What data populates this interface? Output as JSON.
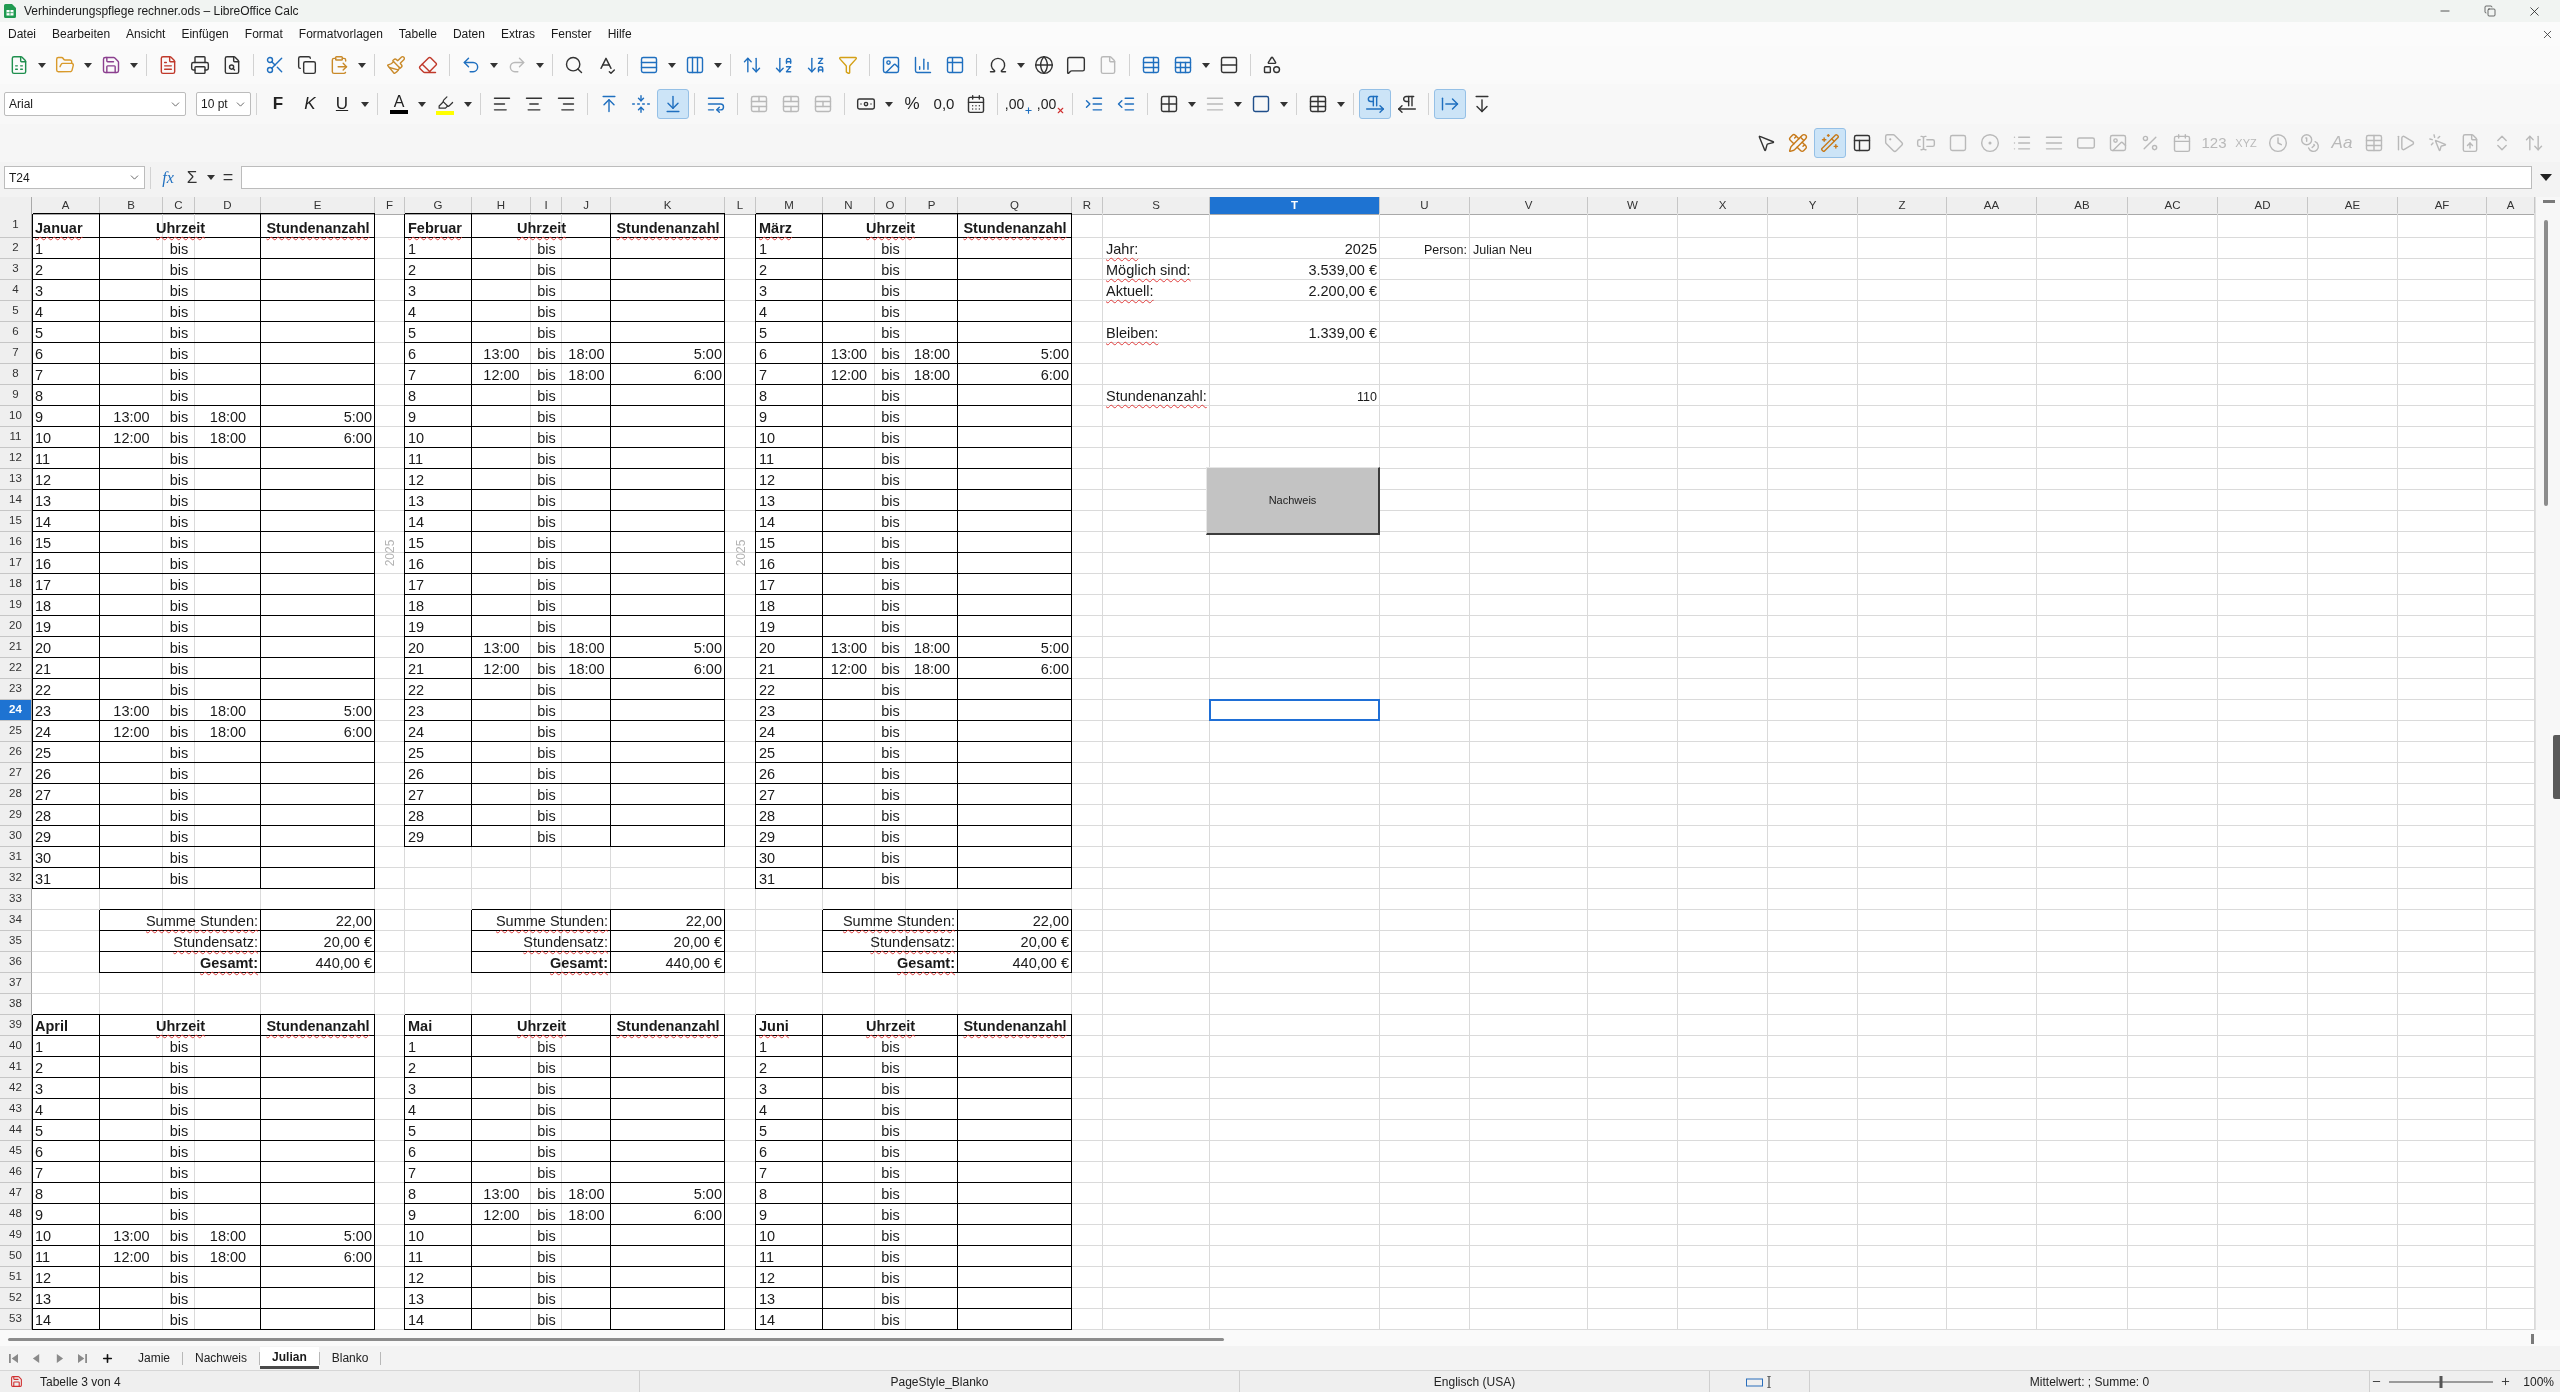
{
  "window": {
    "title": "Verhinderungspflege rechner.ods – LibreOffice Calc"
  },
  "menu": [
    "Datei",
    "Bearbeiten",
    "Ansicht",
    "Einfügen",
    "Format",
    "Formatvorlagen",
    "Tabelle",
    "Daten",
    "Extras",
    "Fenster",
    "Hilfe"
  ],
  "standard_toolbar": [
    {
      "disabled": false
    },
    {
      "disabled": false
    },
    {
      "disabled": false
    },
    {
      "disabled": false
    },
    {
      "disabled": false
    },
    {
      "disabled": false
    },
    {
      "disabled": false
    },
    {
      "disabled": false
    },
    {
      "disabled": false
    },
    {
      "disabled": false
    },
    {
      "disabled": false
    },
    {
      "disabled": false
    },
    {
      "disabled": true
    },
    {
      "disabled": false
    },
    {
      "disabled": false
    },
    {
      "disabled": false
    },
    {
      "disabled": false
    },
    {
      "disabled": false
    },
    {
      "disabled": false
    },
    {
      "disabled": false
    },
    {
      "disabled": false
    },
    {
      "disabled": false
    },
    {
      "disabled": false
    },
    {
      "disabled": false
    },
    {
      "disabled": false
    },
    {
      "disabled": false
    },
    {
      "disabled": false
    },
    {
      "disabled": true
    },
    {
      "disabled": false
    },
    {
      "disabled": false
    },
    {
      "disabled": false
    },
    {
      "disabled": false
    }
  ],
  "formatting_toolbar": {
    "font_name": "Arial",
    "font_size": "10 pt",
    "buttons": [
      {
        "kind": "glyph",
        "label": "F",
        "pressed": false,
        "disabled": false
      },
      {
        "kind": "glyph",
        "label": "K",
        "pressed": false,
        "disabled": false
      },
      {
        "kind": "glyph",
        "label": "U",
        "pressed": false,
        "disabled": false
      },
      {
        "kind": "glyph",
        "label": "A",
        "pressed": false,
        "disabled": false
      },
      {
        "kind": "icon",
        "pressed": false,
        "disabled": false
      },
      {
        "kind": "icon",
        "pressed": false,
        "disabled": false
      },
      {
        "kind": "icon",
        "pressed": false,
        "disabled": false
      },
      {
        "kind": "icon",
        "pressed": false,
        "disabled": false
      },
      {
        "kind": "icon",
        "pressed": false,
        "disabled": false
      },
      {
        "kind": "icon",
        "pressed": false,
        "disabled": false
      },
      {
        "kind": "icon",
        "pressed": true,
        "disabled": false
      },
      {
        "kind": "icon",
        "pressed": false,
        "disabled": false
      },
      {
        "kind": "icon",
        "pressed": false,
        "disabled": true
      },
      {
        "kind": "icon",
        "pressed": false,
        "disabled": true
      },
      {
        "kind": "icon",
        "pressed": false,
        "disabled": true
      },
      {
        "kind": "icon",
        "pressed": false,
        "disabled": false
      },
      {
        "kind": "glyph",
        "label": "%",
        "pressed": false,
        "disabled": false
      },
      {
        "kind": "glyph",
        "label": "0,0",
        "pressed": false,
        "disabled": false
      },
      {
        "kind": "icon",
        "pressed": false,
        "disabled": false
      },
      {
        "kind": "glyph",
        "label": ",00",
        "pressed": false,
        "disabled": false
      },
      {
        "kind": "glyph",
        "label": ",00",
        "pressed": false,
        "disabled": false
      },
      {
        "kind": "icon",
        "pressed": false,
        "disabled": false
      },
      {
        "kind": "icon",
        "pressed": false,
        "disabled": false
      },
      {
        "kind": "icon",
        "pressed": false,
        "disabled": false
      },
      {
        "kind": "icon",
        "pressed": false,
        "disabled": true
      },
      {
        "kind": "icon",
        "pressed": false,
        "disabled": false
      },
      {
        "kind": "icon",
        "pressed": false,
        "disabled": false
      },
      {
        "kind": "icon",
        "pressed": true,
        "disabled": false
      },
      {
        "kind": "icon",
        "pressed": false,
        "disabled": false
      },
      {
        "kind": "icon",
        "pressed": true,
        "disabled": false
      },
      {
        "kind": "icon",
        "pressed": false,
        "disabled": false
      }
    ]
  },
  "form_controls_toolbar": [
    {
      "kind": "icon",
      "pressed": false,
      "disabled": false
    },
    {
      "kind": "icon",
      "pressed": false,
      "disabled": false
    },
    {
      "kind": "icon",
      "pressed": true,
      "disabled": false
    },
    {
      "kind": "icon",
      "pressed": false,
      "disabled": false
    },
    {
      "kind": "icon",
      "pressed": false,
      "disabled": true
    },
    {
      "kind": "icon",
      "pressed": false,
      "disabled": true
    },
    {
      "kind": "icon",
      "pressed": false,
      "disabled": true
    },
    {
      "kind": "icon",
      "pressed": false,
      "disabled": true
    },
    {
      "kind": "icon",
      "pressed": false,
      "disabled": true
    },
    {
      "kind": "icon",
      "pressed": false,
      "disabled": true
    },
    {
      "kind": "icon",
      "pressed": false,
      "disabled": true
    },
    {
      "kind": "icon",
      "pressed": false,
      "disabled": true
    },
    {
      "kind": "icon",
      "pressed": false,
      "disabled": true
    },
    {
      "kind": "icon",
      "pressed": false,
      "disabled": true
    },
    {
      "kind": "glyph",
      "label": "123",
      "pressed": false,
      "disabled": true
    },
    {
      "kind": "glyph",
      "label": "XYZ",
      "pressed": false,
      "disabled": true
    },
    {
      "kind": "icon",
      "pressed": false,
      "disabled": true
    },
    {
      "kind": "icon",
      "pressed": false,
      "disabled": true
    },
    {
      "kind": "glyph",
      "label": "Aa",
      "pressed": false,
      "disabled": true
    },
    {
      "kind": "icon",
      "pressed": false,
      "disabled": true
    },
    {
      "kind": "icon",
      "pressed": false,
      "disabled": true
    },
    {
      "kind": "icon",
      "pressed": false,
      "disabled": true
    },
    {
      "kind": "icon",
      "pressed": false,
      "disabled": true
    },
    {
      "kind": "icon",
      "pressed": false,
      "disabled": true
    },
    {
      "kind": "icon",
      "pressed": false,
      "disabled": true
    }
  ],
  "formula_bar": {
    "name_box": "T24",
    "function_wizard": "fx",
    "sum": "Σ",
    "equals": "="
  },
  "sheet": {
    "columns": [
      {
        "label": "A",
        "selected": false
      },
      {
        "label": "B",
        "selected": false
      },
      {
        "label": "C",
        "selected": false
      },
      {
        "label": "D",
        "selected": false
      },
      {
        "label": "E",
        "selected": false
      },
      {
        "label": "F",
        "selected": false
      },
      {
        "label": "G",
        "selected": false
      },
      {
        "label": "H",
        "selected": false
      },
      {
        "label": "I",
        "selected": false
      },
      {
        "label": "J",
        "selected": false
      },
      {
        "label": "K",
        "selected": false
      },
      {
        "label": "L",
        "selected": false
      },
      {
        "label": "M",
        "selected": false
      },
      {
        "label": "N",
        "selected": false
      },
      {
        "label": "O",
        "selected": false
      },
      {
        "label": "P",
        "selected": false
      },
      {
        "label": "Q",
        "selected": false
      },
      {
        "label": "R",
        "selected": false
      },
      {
        "label": "S",
        "selected": false
      },
      {
        "label": "T",
        "selected": true
      },
      {
        "label": "U",
        "selected": false
      },
      {
        "label": "V",
        "selected": false
      },
      {
        "label": "W",
        "selected": false
      },
      {
        "label": "X",
        "selected": false
      },
      {
        "label": "Y",
        "selected": false
      },
      {
        "label": "Z",
        "selected": false
      },
      {
        "label": "AA",
        "selected": false
      },
      {
        "label": "AB",
        "selected": false
      },
      {
        "label": "AC",
        "selected": false
      },
      {
        "label": "AD",
        "selected": false
      },
      {
        "label": "AE",
        "selected": false
      },
      {
        "label": "AF",
        "selected": false
      },
      {
        "label": "A",
        "selected": false
      }
    ],
    "rows": [
      {
        "label": "1",
        "selected": false
      },
      {
        "label": "2",
        "selected": false
      },
      {
        "label": "3",
        "selected": false
      },
      {
        "label": "4",
        "selected": false
      },
      {
        "label": "5",
        "selected": false
      },
      {
        "label": "6",
        "selected": false
      },
      {
        "label": "7",
        "selected": false
      },
      {
        "label": "8",
        "selected": false
      },
      {
        "label": "9",
        "selected": false
      },
      {
        "label": "10",
        "selected": false
      },
      {
        "label": "11",
        "selected": false
      },
      {
        "label": "12",
        "selected": false
      },
      {
        "label": "13",
        "selected": false
      },
      {
        "label": "14",
        "selected": false
      },
      {
        "label": "15",
        "selected": false
      },
      {
        "label": "16",
        "selected": false
      },
      {
        "label": "17",
        "selected": false
      },
      {
        "label": "18",
        "selected": false
      },
      {
        "label": "19",
        "selected": false
      },
      {
        "label": "20",
        "selected": false
      },
      {
        "label": "21",
        "selected": false
      },
      {
        "label": "22",
        "selected": false
      },
      {
        "label": "23",
        "selected": false
      },
      {
        "label": "24",
        "selected": true
      },
      {
        "label": "25",
        "selected": false
      },
      {
        "label": "26",
        "selected": false
      },
      {
        "label": "27",
        "selected": false
      },
      {
        "label": "28",
        "selected": false
      },
      {
        "label": "29",
        "selected": false
      },
      {
        "label": "30",
        "selected": false
      },
      {
        "label": "31",
        "selected": false
      },
      {
        "label": "32",
        "selected": false
      },
      {
        "label": "33",
        "selected": false
      },
      {
        "label": "34",
        "selected": false
      },
      {
        "label": "35",
        "selected": false
      },
      {
        "label": "36",
        "selected": false
      },
      {
        "label": "37",
        "selected": false
      },
      {
        "label": "38",
        "selected": false
      },
      {
        "label": "39",
        "selected": false
      },
      {
        "label": "40",
        "selected": false
      },
      {
        "label": "41",
        "selected": false
      },
      {
        "label": "42",
        "selected": false
      },
      {
        "label": "43",
        "selected": false
      },
      {
        "label": "44",
        "selected": false
      },
      {
        "label": "45",
        "selected": false
      },
      {
        "label": "46",
        "selected": false
      },
      {
        "label": "47",
        "selected": false
      },
      {
        "label": "48",
        "selected": false
      },
      {
        "label": "49",
        "selected": false
      },
      {
        "label": "50",
        "selected": false
      },
      {
        "label": "51",
        "selected": false
      },
      {
        "label": "52",
        "selected": false
      },
      {
        "label": "53",
        "selected": false
      }
    ],
    "month_tables": [
      {
        "title": "Januar",
        "misspelled": true,
        "time_header": "Uhrzeit",
        "hours_header": "Stundenanzahl",
        "days": [
          {
            "day": "1",
            "separator": "bis"
          },
          {
            "day": "2",
            "separator": "bis"
          },
          {
            "day": "3",
            "separator": "bis"
          },
          {
            "day": "4",
            "separator": "bis"
          },
          {
            "day": "5",
            "separator": "bis"
          },
          {
            "day": "6",
            "separator": "bis"
          },
          {
            "day": "7",
            "separator": "bis"
          },
          {
            "day": "8",
            "separator": "bis"
          },
          {
            "day": "9",
            "from": "13:00",
            "separator": "bis",
            "to": "18:00",
            "hours": "5:00"
          },
          {
            "day": "10",
            "from": "12:00",
            "separator": "bis",
            "to": "18:00",
            "hours": "6:00"
          },
          {
            "day": "11",
            "separator": "bis"
          },
          {
            "day": "12",
            "separator": "bis"
          },
          {
            "day": "13",
            "separator": "bis"
          },
          {
            "day": "14",
            "separator": "bis"
          },
          {
            "day": "15",
            "separator": "bis"
          },
          {
            "day": "16",
            "separator": "bis"
          },
          {
            "day": "17",
            "separator": "bis"
          },
          {
            "day": "18",
            "separator": "bis"
          },
          {
            "day": "19",
            "separator": "bis"
          },
          {
            "day": "20",
            "separator": "bis"
          },
          {
            "day": "21",
            "separator": "bis"
          },
          {
            "day": "22",
            "separator": "bis"
          },
          {
            "day": "23",
            "from": "13:00",
            "separator": "bis",
            "to": "18:00",
            "hours": "5:00"
          },
          {
            "day": "24",
            "from": "12:00",
            "separator": "bis",
            "to": "18:00",
            "hours": "6:00"
          },
          {
            "day": "25",
            "separator": "bis"
          },
          {
            "day": "26",
            "separator": "bis"
          },
          {
            "day": "27",
            "separator": "bis"
          },
          {
            "day": "28",
            "separator": "bis"
          },
          {
            "day": "29",
            "separator": "bis"
          },
          {
            "day": "30",
            "separator": "bis"
          },
          {
            "day": "31",
            "separator": "bis"
          }
        ],
        "totals": [
          {
            "kind": "line",
            "label": "Summe Stunden:",
            "value": "22,00"
          },
          {
            "kind": "line",
            "label": "Stundensatz:",
            "value": "20,00 €"
          },
          {
            "kind": "total",
            "label": "Gesamt:",
            "value": "440,00 €"
          }
        ]
      },
      {
        "title": "Februar",
        "misspelled": true,
        "time_header": "Uhrzeit",
        "hours_header": "Stundenanzahl",
        "days": [
          {
            "day": "1",
            "separator": "bis"
          },
          {
            "day": "2",
            "separator": "bis"
          },
          {
            "day": "3",
            "separator": "bis"
          },
          {
            "day": "4",
            "separator": "bis"
          },
          {
            "day": "5",
            "separator": "bis"
          },
          {
            "day": "6",
            "from": "13:00",
            "separator": "bis",
            "to": "18:00",
            "hours": "5:00"
          },
          {
            "day": "7",
            "from": "12:00",
            "separator": "bis",
            "to": "18:00",
            "hours": "6:00"
          },
          {
            "day": "8",
            "separator": "bis"
          },
          {
            "day": "9",
            "separator": "bis"
          },
          {
            "day": "10",
            "separator": "bis"
          },
          {
            "day": "11",
            "separator": "bis"
          },
          {
            "day": "12",
            "separator": "bis"
          },
          {
            "day": "13",
            "separator": "bis"
          },
          {
            "day": "14",
            "separator": "bis"
          },
          {
            "day": "15",
            "separator": "bis"
          },
          {
            "day": "16",
            "separator": "bis"
          },
          {
            "day": "17",
            "separator": "bis"
          },
          {
            "day": "18",
            "separator": "bis"
          },
          {
            "day": "19",
            "separator": "bis"
          },
          {
            "day": "20",
            "from": "13:00",
            "separator": "bis",
            "to": "18:00",
            "hours": "5:00"
          },
          {
            "day": "21",
            "from": "12:00",
            "separator": "bis",
            "to": "18:00",
            "hours": "6:00"
          },
          {
            "day": "22",
            "separator": "bis"
          },
          {
            "day": "23",
            "separator": "bis"
          },
          {
            "day": "24",
            "separator": "bis"
          },
          {
            "day": "25",
            "separator": "bis"
          },
          {
            "day": "26",
            "separator": "bis"
          },
          {
            "day": "27",
            "separator": "bis"
          },
          {
            "day": "28",
            "separator": "bis"
          },
          {
            "day": "29",
            "separator": "bis"
          }
        ],
        "totals": [
          {
            "kind": "line",
            "label": "Summe Stunden:",
            "value": "22,00"
          },
          {
            "kind": "line",
            "label": "Stundensatz:",
            "value": "20,00 €"
          },
          {
            "kind": "total",
            "label": "Gesamt:",
            "value": "440,00 €"
          }
        ]
      },
      {
        "title": "März",
        "misspelled": true,
        "time_header": "Uhrzeit",
        "hours_header": "Stundenanzahl",
        "days": [
          {
            "day": "1",
            "separator": "bis"
          },
          {
            "day": "2",
            "separator": "bis"
          },
          {
            "day": "3",
            "separator": "bis"
          },
          {
            "day": "4",
            "separator": "bis"
          },
          {
            "day": "5",
            "separator": "bis"
          },
          {
            "day": "6",
            "from": "13:00",
            "separator": "bis",
            "to": "18:00",
            "hours": "5:00"
          },
          {
            "day": "7",
            "from": "12:00",
            "separator": "bis",
            "to": "18:00",
            "hours": "6:00"
          },
          {
            "day": "8",
            "separator": "bis"
          },
          {
            "day": "9",
            "separator": "bis"
          },
          {
            "day": "10",
            "separator": "bis"
          },
          {
            "day": "11",
            "separator": "bis"
          },
          {
            "day": "12",
            "separator": "bis"
          },
          {
            "day": "13",
            "separator": "bis"
          },
          {
            "day": "14",
            "separator": "bis"
          },
          {
            "day": "15",
            "separator": "bis"
          },
          {
            "day": "16",
            "separator": "bis"
          },
          {
            "day": "17",
            "separator": "bis"
          },
          {
            "day": "18",
            "separator": "bis"
          },
          {
            "day": "19",
            "separator": "bis"
          },
          {
            "day": "20",
            "from": "13:00",
            "separator": "bis",
            "to": "18:00",
            "hours": "5:00"
          },
          {
            "day": "21",
            "from": "12:00",
            "separator": "bis",
            "to": "18:00",
            "hours": "6:00"
          },
          {
            "day": "22",
            "separator": "bis"
          },
          {
            "day": "23",
            "separator": "bis"
          },
          {
            "day": "24",
            "separator": "bis"
          },
          {
            "day": "25",
            "separator": "bis"
          },
          {
            "day": "26",
            "separator": "bis"
          },
          {
            "day": "27",
            "separator": "bis"
          },
          {
            "day": "28",
            "separator": "bis"
          },
          {
            "day": "29",
            "separator": "bis"
          },
          {
            "day": "30",
            "separator": "bis"
          },
          {
            "day": "31",
            "separator": "bis"
          }
        ],
        "totals": [
          {
            "kind": "line",
            "label": "Summe Stunden:",
            "value": "22,00"
          },
          {
            "kind": "line",
            "label": "Stundensatz:",
            "value": "20,00 €"
          },
          {
            "kind": "total",
            "label": "Gesamt:",
            "value": "440,00 €"
          }
        ]
      },
      {
        "title": "April",
        "misspelled": false,
        "time_header": "Uhrzeit",
        "hours_header": "Stundenanzahl",
        "days": [
          {
            "day": "1",
            "separator": "bis"
          },
          {
            "day": "2",
            "separator": "bis"
          },
          {
            "day": "3",
            "separator": "bis"
          },
          {
            "day": "4",
            "separator": "bis"
          },
          {
            "day": "5",
            "separator": "bis"
          },
          {
            "day": "6",
            "separator": "bis"
          },
          {
            "day": "7",
            "separator": "bis"
          },
          {
            "day": "8",
            "separator": "bis"
          },
          {
            "day": "9",
            "separator": "bis"
          },
          {
            "day": "10",
            "from": "13:00",
            "separator": "bis",
            "to": "18:00",
            "hours": "5:00"
          },
          {
            "day": "11",
            "from": "12:00",
            "separator": "bis",
            "to": "18:00",
            "hours": "6:00"
          },
          {
            "day": "12",
            "separator": "bis"
          },
          {
            "day": "13",
            "separator": "bis"
          },
          {
            "day": "14",
            "separator": "bis"
          }
        ]
      },
      {
        "title": "Mai",
        "misspelled": false,
        "time_header": "Uhrzeit",
        "hours_header": "Stundenanzahl",
        "days": [
          {
            "day": "1",
            "separator": "bis"
          },
          {
            "day": "2",
            "separator": "bis"
          },
          {
            "day": "3",
            "separator": "bis"
          },
          {
            "day": "4",
            "separator": "bis"
          },
          {
            "day": "5",
            "separator": "bis"
          },
          {
            "day": "6",
            "separator": "bis"
          },
          {
            "day": "7",
            "separator": "bis"
          },
          {
            "day": "8",
            "from": "13:00",
            "separator": "bis",
            "to": "18:00",
            "hours": "5:00"
          },
          {
            "day": "9",
            "from": "12:00",
            "separator": "bis",
            "to": "18:00",
            "hours": "6:00"
          },
          {
            "day": "10",
            "separator": "bis"
          },
          {
            "day": "11",
            "separator": "bis"
          },
          {
            "day": "12",
            "separator": "bis"
          },
          {
            "day": "13",
            "separator": "bis"
          },
          {
            "day": "14",
            "separator": "bis"
          }
        ]
      },
      {
        "title": "Juni",
        "misspelled": true,
        "time_header": "Uhrzeit",
        "hours_header": "Stundenanzahl",
        "days": [
          {
            "day": "1",
            "separator": "bis"
          },
          {
            "day": "2",
            "separator": "bis"
          },
          {
            "day": "3",
            "separator": "bis"
          },
          {
            "day": "4",
            "separator": "bis"
          },
          {
            "day": "5",
            "separator": "bis"
          },
          {
            "day": "6",
            "separator": "bis"
          },
          {
            "day": "7",
            "separator": "bis"
          },
          {
            "day": "8",
            "separator": "bis"
          },
          {
            "day": "9",
            "separator": "bis"
          },
          {
            "day": "10",
            "separator": "bis"
          },
          {
            "day": "11",
            "separator": "bis"
          },
          {
            "day": "12",
            "separator": "bis"
          },
          {
            "day": "13",
            "separator": "bis"
          },
          {
            "day": "14",
            "separator": "bis"
          }
        ]
      }
    ],
    "vertical_labels": [
      {
        "text": "2025"
      },
      {
        "text": "2025"
      }
    ],
    "overview": [
      {
        "kind": "regular",
        "label": "Jahr:",
        "value": "2025"
      },
      {
        "kind": "regular",
        "label": "Möglich sind:",
        "value": "3.539,00 €"
      },
      {
        "kind": "regular",
        "label": "Aktuell:",
        "value": "2.200,00 €"
      },
      {
        "kind": "regular",
        "label": "Bleiben:",
        "value": "1.339,00 €"
      },
      {
        "kind": "small",
        "label": "Stundenanzahl:",
        "value": "110"
      }
    ],
    "person": {
      "label": "Person:",
      "name": "Julian Neu"
    },
    "form_button": {
      "label": "Nachweis"
    }
  },
  "sheet_tabs": [
    {
      "label": "Jamie",
      "selected": false
    },
    {
      "label": "Nachweis",
      "selected": false
    },
    {
      "label": "Julian",
      "selected": true
    },
    {
      "label": "Blanko",
      "selected": false
    }
  ],
  "status_bar": {
    "sheet_position": "Tabelle 3 von 4",
    "page_style": "PageStyle_Blanko",
    "language": "Englisch (USA)",
    "selection_summary": "Mittelwert: ; Summe: 0",
    "zoom_slider": {
      "level": 0.5
    },
    "zoom": "100%"
  }
}
